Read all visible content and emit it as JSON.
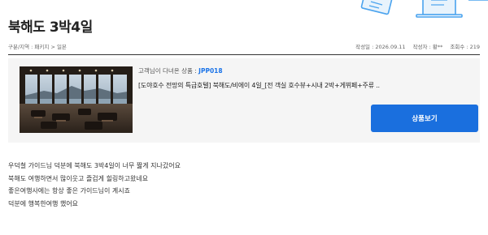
{
  "post": {
    "title": "북해도 3박4일",
    "breadcrumb": "구분/지역 : 패키지 > 일본",
    "created": "작성일 : 2026.09.11",
    "author": "작성자 : 황**",
    "views": "조회수 : 219"
  },
  "product": {
    "sub_prefix": "고객님이 다녀온 상품 : ",
    "code": "JPP018",
    "title": "[도야호수 전망의 특급호텔] 북해도/비에이 4일_[전 객실 호수뷰+시내 2박+게뷔페+주류 ..",
    "button_label": "상품보기",
    "image_icon": "hotel-lounge-lake-view-photo"
  },
  "body": {
    "lines": [
      "우덕철 가이드님 덕분에 북해도 3박4일이 너무 짧게 지나갔어요",
      "북해도 여행하면서 많이웃고 즐겁게 힐링하고왔네요",
      "좋은여행사에는 항상 좋은 가이드님이 계시죠",
      "덕분에 행복한여행 했어요"
    ]
  },
  "decoration": {
    "icon": "travel-illustration-icon",
    "accent": "#4aa3ee"
  }
}
